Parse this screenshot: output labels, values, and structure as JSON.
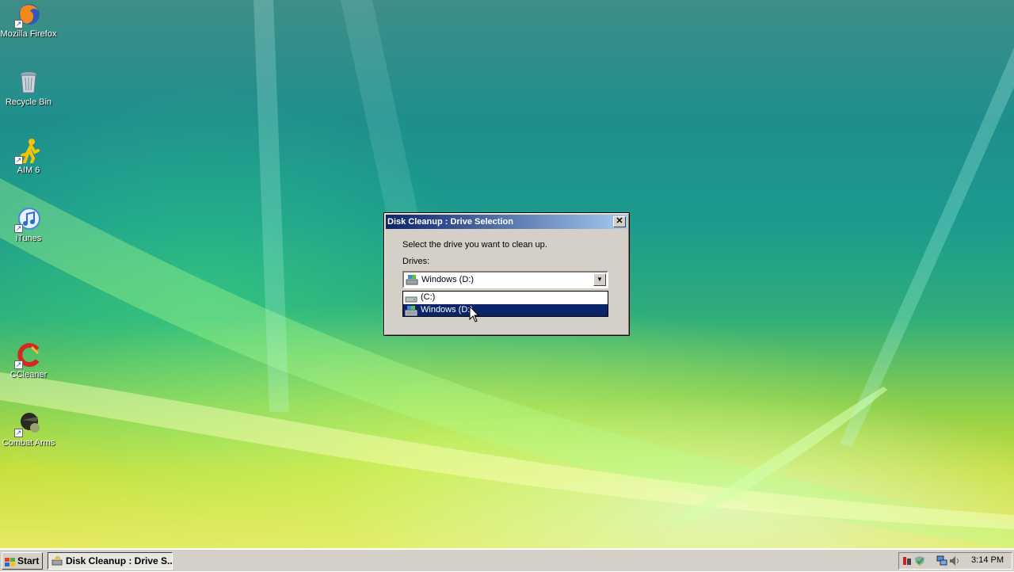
{
  "desktop": {
    "icons": [
      {
        "label": "Mozilla Firefox",
        "icon": "firefox-icon"
      },
      {
        "label": "Recycle Bin",
        "icon": "recycle-bin-icon"
      },
      {
        "label": "AIM 6",
        "icon": "aim-icon"
      },
      {
        "label": "iTunes",
        "icon": "itunes-icon"
      },
      {
        "label": "CCleaner",
        "icon": "ccleaner-icon"
      },
      {
        "label": "Combat Arms",
        "icon": "combat-arms-icon"
      }
    ]
  },
  "dialog": {
    "title": "Disk Cleanup : Drive Selection",
    "close_label": "✕",
    "instruction": "Select the drive you want to clean up.",
    "drives_label": "Drives:",
    "selected_drive": "Windows (D:)",
    "options": [
      "(C:)",
      "Windows (D:)"
    ],
    "highlighted_option": "Windows (D:)"
  },
  "taskbar": {
    "start_label": "Start",
    "task_label": "Disk Cleanup : Drive S...",
    "clock": "3:14 PM",
    "tray_icons": [
      "security-icon",
      "shield-check-icon",
      "network-icon",
      "volume-icon"
    ]
  },
  "colors": {
    "titlebar_start": "#0a246a",
    "titlebar_end": "#a6caf0",
    "selection": "#0a246a",
    "dialog_face": "#d4d0c8"
  }
}
